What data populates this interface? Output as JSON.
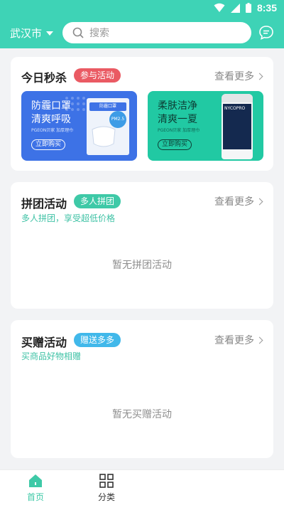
{
  "status_bar": {
    "time": "8:35"
  },
  "header": {
    "city": "武汉市",
    "search_placeholder": "搜索",
    "icons": {
      "location_caret": "caret-down-icon",
      "search": "search-icon",
      "message": "chat-bubble-icon"
    }
  },
  "flash_sale": {
    "title": "今日秒杀",
    "tag": "参与活动",
    "more": "查看更多",
    "banners": [
      {
        "title_line1": "防霾口罩",
        "title_line2": "清爽呼吸",
        "subtitle": "PGEON贝家 加厚理巾",
        "button": "立即购买",
        "product_text": "防霾口罩",
        "badge": "PM2.5"
      },
      {
        "title_line1": "柔肤洁净",
        "title_line2": "清爽一夏",
        "subtitle": "PGEON贝家 加厚理巾",
        "button": "立即购买",
        "product_text": "NYCOPRO"
      }
    ]
  },
  "group_buy": {
    "title": "拼团活动",
    "tag": "多人拼团",
    "more": "查看更多",
    "subtitle": "多人拼团，享受超低价格",
    "empty": "暂无拼团活动"
  },
  "gift": {
    "title": "买赠活动",
    "tag": "赠送多多",
    "more": "查看更多",
    "subtitle": "买商品好物相赠",
    "empty": "暂无买赠活动"
  },
  "tabbar": {
    "items": [
      {
        "label": "首页",
        "icon": "home-icon",
        "active": true
      },
      {
        "label": "分类",
        "icon": "grid-icon",
        "active": false
      }
    ]
  },
  "colors": {
    "brand": "#3ed3b6",
    "tag_red": "#ea5a63",
    "tag_green": "#3ec9a7",
    "tag_blue": "#41b8ea",
    "banner_blue": "#3d72e6",
    "banner_green": "#21c9a3"
  }
}
